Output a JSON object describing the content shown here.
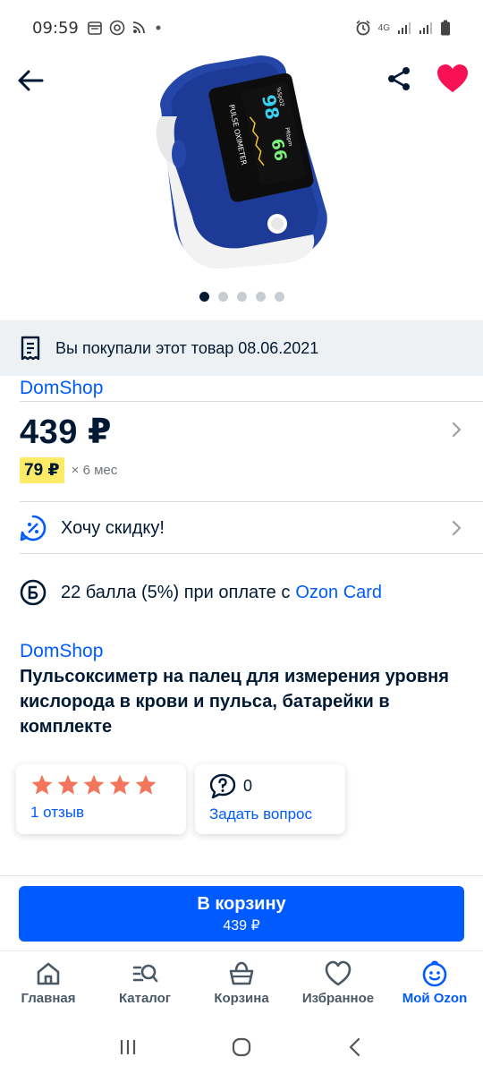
{
  "status_bar": {
    "time": "09:59",
    "network": "4G",
    "icons_left": [
      "calendar-icon",
      "at-icon",
      "rss-icon",
      "dot-icon"
    ],
    "icons_right": [
      "alarm-icon",
      "signal-icon",
      "signal-icon",
      "battery-icon"
    ]
  },
  "header": {
    "back_icon": "arrow-left-icon",
    "share_icon": "share-icon",
    "favorite_icon": "heart-filled-icon",
    "favorite_color": "#f91155"
  },
  "gallery": {
    "image_count": 5,
    "active_index": 0,
    "device_texts": {
      "brand_label": "PULSE OXIMETER",
      "spo2_label": "%SpO2",
      "spo2_value": "98",
      "pr_label": "PRbpm",
      "pr_value": "66"
    }
  },
  "purchase_notice": {
    "icon": "receipt-icon",
    "text": "Вы покупали этот товар 08.06.2021"
  },
  "seller_top": "DomShop",
  "price": {
    "value": "439 ₽",
    "installment_price": "79 ₽",
    "installment_term": "× 6 мес"
  },
  "discount": {
    "icon": "discount-icon",
    "label": "Хочу скидку!"
  },
  "bonus": {
    "icon": "bonus-b-icon",
    "text": "22 балла (5%) при оплате с",
    "link": "Ozon Card"
  },
  "product": {
    "seller": "DomShop",
    "title": "Пульсоксиметр на палец для измерения уровня кислорода в крови и пульса, батарейки в комплекте"
  },
  "rating": {
    "stars": 5,
    "star_color": "#f2765b",
    "reviews_link": "1 отзыв"
  },
  "questions": {
    "count": "0",
    "link": "Задать вопрос"
  },
  "cart_button": {
    "label": "В корзину",
    "price": "439 ₽",
    "color": "#005bff"
  },
  "bottom_nav": {
    "items": [
      {
        "label": "Главная",
        "icon": "home-icon"
      },
      {
        "label": "Каталог",
        "icon": "catalog-search-icon"
      },
      {
        "label": "Корзина",
        "icon": "basket-icon"
      },
      {
        "label": "Избранное",
        "icon": "heart-outline-icon"
      },
      {
        "label": "Мой Ozon",
        "icon": "smile-icon",
        "active": true
      }
    ]
  },
  "system_nav": [
    "recents-icon",
    "home-circle-icon",
    "back-chevron-icon"
  ]
}
